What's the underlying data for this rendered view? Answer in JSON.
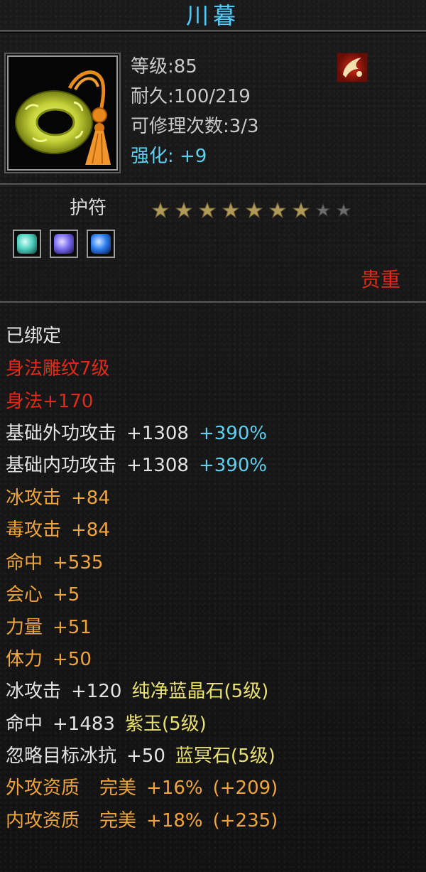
{
  "item": {
    "name": "川暮",
    "level_line": "等级:85",
    "durability_line": "耐久:100/219",
    "repair_line": "可修理次数:3/3",
    "enhance_line": "强化: +9",
    "type": "护符",
    "rarity": "贵重",
    "stars_filled": 7,
    "stars_total": 9
  },
  "gems": [
    {
      "name": "green-gem-icon",
      "color": "#4fd0c0"
    },
    {
      "name": "purple-gem-icon",
      "color": "#7a6cf0"
    },
    {
      "name": "blue-gem-icon",
      "color": "#2f7ef0"
    }
  ],
  "colors": {
    "title": "#57c9f5",
    "red": "#e02a1a",
    "cyan": "#5fd0f0",
    "orange": "#f0a43c",
    "yellow": "#e8e070",
    "white": "#e3e3e3"
  },
  "attributes": {
    "bound": "已绑定",
    "carving": "身法雕纹7级",
    "agility": "身法+170",
    "ext_attack": {
      "label": "基础外功攻击",
      "value": "+1308",
      "pct": "+390%"
    },
    "int_attack": {
      "label": "基础内功攻击",
      "value": "+1308",
      "pct": "+390%"
    },
    "ice_attack": {
      "label": "冰攻击",
      "value": "+84"
    },
    "poison_attack": {
      "label": "毒攻击",
      "value": "+84"
    },
    "hit": {
      "label": "命中",
      "value": "+535"
    },
    "crit": {
      "label": "会心",
      "value": "+5"
    },
    "strength": {
      "label": "力量",
      "value": "+51"
    },
    "stamina": {
      "label": "体力",
      "value": "+50"
    },
    "gem1": {
      "label": "冰攻击",
      "value": "+120",
      "gem": "纯净蓝晶石(5级)"
    },
    "gem2": {
      "label": "命中",
      "value": "+1483",
      "gem": "紫玉(5级)"
    },
    "gem3": {
      "label": "忽略目标冰抗",
      "value": "+50",
      "gem": "蓝冥石(5级)"
    },
    "ext_quality": {
      "label": "外攻资质",
      "grade": "完美",
      "pct": "+16%",
      "bonus": "(+209)"
    },
    "int_quality": {
      "label": "内攻资质",
      "grade": "完美",
      "pct": "+18%",
      "bonus": "(+235)"
    }
  }
}
